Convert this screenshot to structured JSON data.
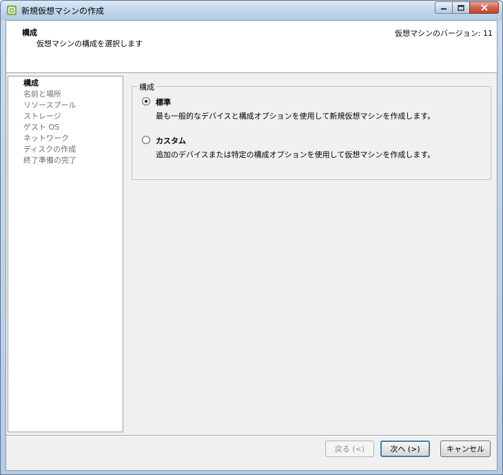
{
  "window": {
    "title": "新規仮想マシンの作成"
  },
  "header": {
    "title": "構成",
    "subtitle": "仮想マシンの構成を選択します",
    "version": "仮想マシンのバージョン: 11"
  },
  "nav": {
    "items": [
      {
        "label": "構成",
        "active": true
      },
      {
        "label": "名前と場所"
      },
      {
        "label": "リソースプール"
      },
      {
        "label": "ストレージ"
      },
      {
        "label": "ゲスト OS"
      },
      {
        "label": "ネットワーク"
      },
      {
        "label": "ディスクの作成"
      },
      {
        "label": "終了準備の完了"
      }
    ]
  },
  "config": {
    "legend": "構成",
    "options": [
      {
        "label": "標準",
        "description": "最も一般的なデバイスと構成オプションを使用して新規仮想マシンを作成します。",
        "selected": true
      },
      {
        "label": "カスタム",
        "description": "追加のデバイスまたは特定の構成オプションを使用して仮想マシンを作成します。",
        "selected": false
      }
    ]
  },
  "buttons": {
    "back": "戻る (<)",
    "next": "次へ (>)",
    "cancel": "キャンセル"
  },
  "icons": {
    "app": "vsphere-app-icon",
    "minimize": "minimize-icon",
    "maximize": "maximize-icon",
    "close": "close-icon"
  }
}
